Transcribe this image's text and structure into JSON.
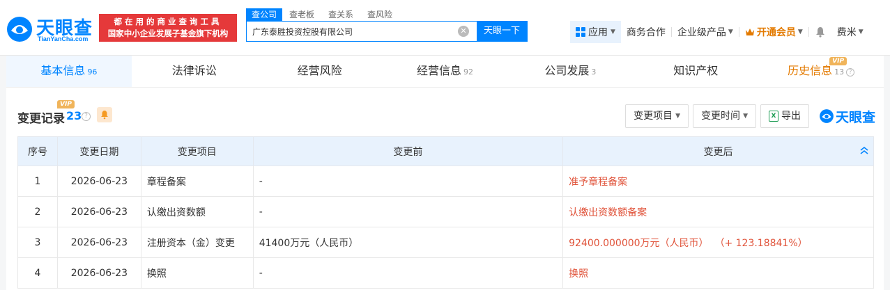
{
  "brand": {
    "name": "天眼查",
    "domain": "TianYanCha.com",
    "mini_name": "天眼查"
  },
  "promo": {
    "line1": "都在用的商业查询工具",
    "line2": "国家中小企业发展子基金旗下机构"
  },
  "search": {
    "tabs": [
      "查公司",
      "查老板",
      "查关系",
      "查风险"
    ],
    "value": "广东泰胜投资控股有限公司",
    "clear_glyph": "✕",
    "button": "天眼一下"
  },
  "nav": {
    "apps": "应用",
    "business": "商务合作",
    "enterprise": "企业级产品",
    "vip": "开通会员",
    "user": "费米"
  },
  "tabs": [
    {
      "label": "基本信息",
      "count": "96"
    },
    {
      "label": "法律诉讼",
      "count": ""
    },
    {
      "label": "经营风险",
      "count": ""
    },
    {
      "label": "经营信息",
      "count": "92"
    },
    {
      "label": "公司发展",
      "count": "3"
    },
    {
      "label": "知识产权",
      "count": ""
    },
    {
      "label": "历史信息",
      "count": "13",
      "badge": "VIP"
    }
  ],
  "section": {
    "title": "变更记录",
    "count": "23",
    "badge": "VIP",
    "help": "?"
  },
  "tools": {
    "item_filter": "变更项目",
    "time_filter": "变更时间",
    "export": "导出",
    "excel_glyph": "X"
  },
  "table": {
    "headers": [
      "序号",
      "变更日期",
      "变更项目",
      "变更前",
      "变更后"
    ],
    "rows": [
      {
        "no": "1",
        "date": "2026-06-23",
        "item": "章程备案",
        "before": "-",
        "after": "准予章程备案"
      },
      {
        "no": "2",
        "date": "2026-06-23",
        "item": "认缴出资数额",
        "before": "-",
        "after": "认缴出资数额备案"
      },
      {
        "no": "3",
        "date": "2026-06-23",
        "item": "注册资本（金）变更",
        "before": "41400万元（人民币）",
        "after": "92400.000000万元（人民币）  （+ 123.18841%）"
      },
      {
        "no": "4",
        "date": "2026-06-23",
        "item": "换照",
        "before": "-",
        "after": "换照"
      }
    ]
  },
  "colors": {
    "accent": "#0084ff",
    "promo_red": "#e5393a",
    "change_red": "#e0533a",
    "vip_orange": "#e37a00"
  }
}
